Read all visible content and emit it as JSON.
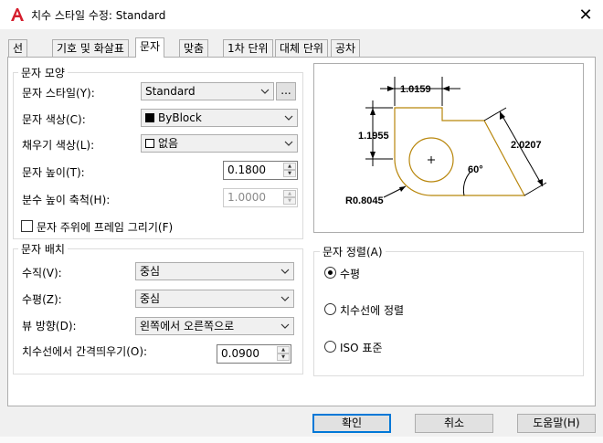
{
  "window": {
    "title": "치수 스타일 수정: Standard",
    "app_icon": "autocad-a-icon",
    "close_glyph": "✕"
  },
  "tabs": [
    {
      "label": "선"
    },
    {
      "label": "기호 및 화살표"
    },
    {
      "label": "문자",
      "active": true
    },
    {
      "label": "맞춤"
    },
    {
      "label": "1차 단위"
    },
    {
      "label": "대체 단위"
    },
    {
      "label": "공차"
    }
  ],
  "text_appearance": {
    "title": "문자 모양",
    "style_label": "문자 스타일(Y):",
    "style_value": "Standard",
    "style_browse_label": "...",
    "color_label": "문자 색상(C):",
    "color_value": "ByBlock",
    "color_swatch": "#000000",
    "fill_label": "채우기 색상(L):",
    "fill_value": "없음",
    "height_label": "문자 높이(T):",
    "height_value": "0.1800",
    "fraction_label": "분수 높이 축척(H):",
    "fraction_value": "1.0000",
    "frame_label": "문자 주위에 프레임 그리기(F)",
    "frame_checked": false
  },
  "text_placement": {
    "title": "문자 배치",
    "vertical_label": "수직(V):",
    "vertical_value": "중심",
    "horizontal_label": "수평(Z):",
    "horizontal_value": "중심",
    "view_label": "뷰 방향(D):",
    "view_value": "왼쪽에서 오른쪽으로",
    "offset_label": "치수선에서 간격띄우기(O):",
    "offset_value": "0.0900"
  },
  "preview": {
    "dim_top": "1.0159",
    "dim_left": "1.1955",
    "dim_right": "2.0207",
    "dim_angle": "60°",
    "dim_radius": "R0.8045",
    "accent_color": "#b8860b"
  },
  "text_alignment": {
    "title": "문자 정렬(A)",
    "options": [
      {
        "label": "수평",
        "selected": true
      },
      {
        "label": "치수선에 정렬",
        "selected": false
      },
      {
        "label": "ISO 표준",
        "selected": false
      }
    ]
  },
  "buttons": {
    "ok": "확인",
    "cancel": "취소",
    "help": "도움말(H)"
  }
}
